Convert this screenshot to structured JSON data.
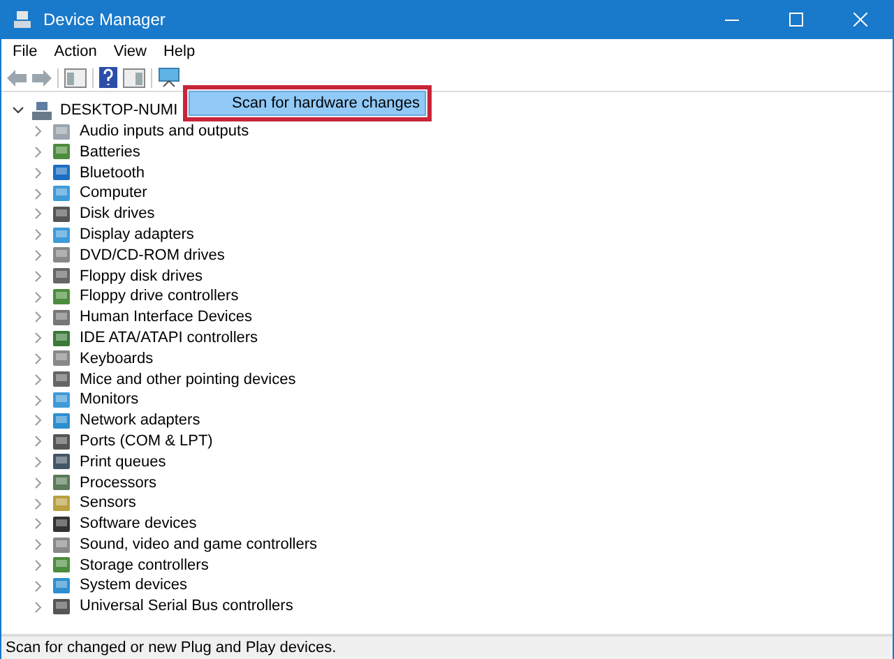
{
  "window": {
    "title": "Device Manager"
  },
  "menu_bar": [
    "File",
    "Action",
    "View",
    "Help"
  ],
  "tree": {
    "label": "DESKTOP-NUMI",
    "expanded": true,
    "children": [
      {
        "label": "Audio inputs and outputs",
        "expanded": false
      },
      {
        "label": "Batteries",
        "expanded": false
      },
      {
        "label": "Bluetooth",
        "expanded": false
      },
      {
        "label": "Computer",
        "expanded": false
      },
      {
        "label": "Disk drives",
        "expanded": false
      },
      {
        "label": "Display adapters",
        "expanded": false
      },
      {
        "label": "DVD/CD-ROM drives",
        "expanded": false
      },
      {
        "label": "Floppy disk drives",
        "expanded": false
      },
      {
        "label": "Floppy drive controllers",
        "expanded": false
      },
      {
        "label": "Human Interface Devices",
        "expanded": false
      },
      {
        "label": "IDE ATA/ATAPI controllers",
        "expanded": false
      },
      {
        "label": "Keyboards",
        "expanded": false
      },
      {
        "label": "Mice and other pointing devices",
        "expanded": false
      },
      {
        "label": "Monitors",
        "expanded": false
      },
      {
        "label": "Network adapters",
        "expanded": false
      },
      {
        "label": "Ports (COM & LPT)",
        "expanded": false
      },
      {
        "label": "Print queues",
        "expanded": false
      },
      {
        "label": "Processors",
        "expanded": false
      },
      {
        "label": "Sensors",
        "expanded": false
      },
      {
        "label": "Software devices",
        "expanded": false
      },
      {
        "label": "Sound, video and game controllers",
        "expanded": false
      },
      {
        "label": "Storage controllers",
        "expanded": false
      },
      {
        "label": "System devices",
        "expanded": false
      },
      {
        "label": "Universal Serial Bus controllers",
        "expanded": false
      }
    ]
  },
  "context_menu": {
    "outlined": true,
    "items": [
      {
        "label": "Scan for hardware changes",
        "selected": true
      }
    ]
  },
  "status_bar": "Scan for changed or new Plug and Play devices."
}
